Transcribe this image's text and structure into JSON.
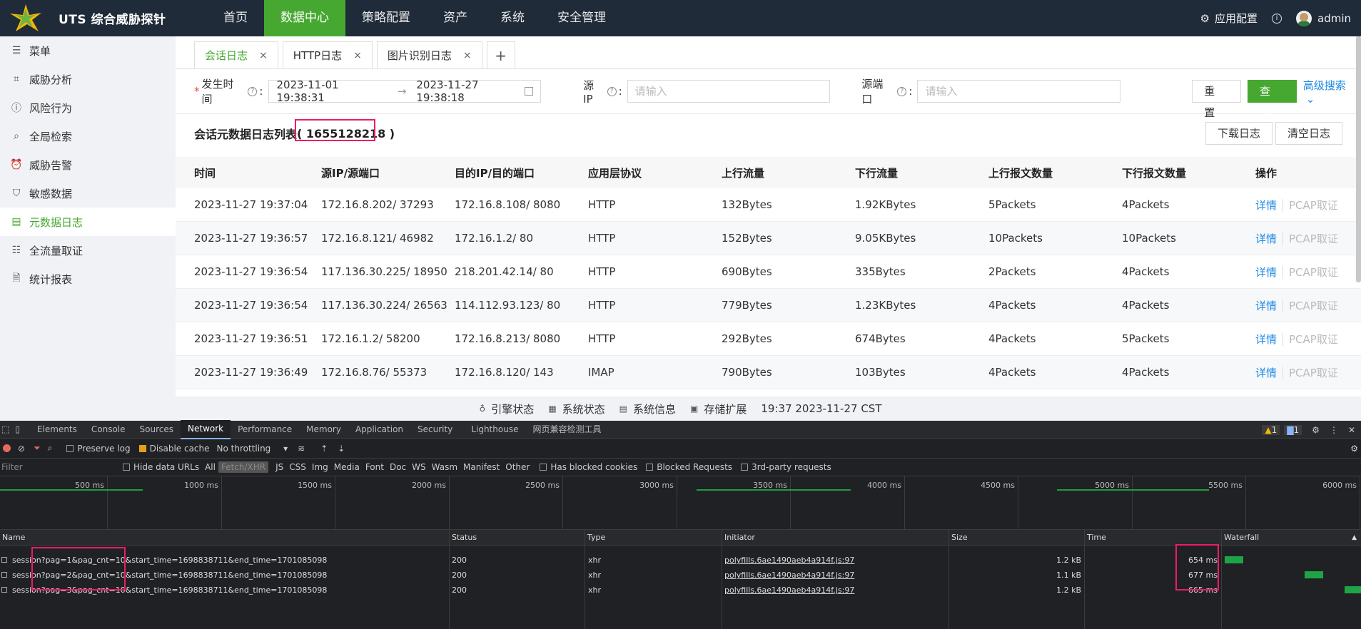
{
  "app": {
    "title": "UTS 综合威胁探针"
  },
  "nav": {
    "items": [
      {
        "label": "首页"
      },
      {
        "label": "数据中心"
      },
      {
        "label": "策略配置"
      },
      {
        "label": "资产"
      },
      {
        "label": "系统"
      },
      {
        "label": "安全管理"
      }
    ],
    "active": "数据中心"
  },
  "top_right": {
    "app_config": "应用配置",
    "user": "admin"
  },
  "sidebar": {
    "items": [
      {
        "label": "菜单",
        "icon": "menu-icon"
      },
      {
        "label": "威胁分析",
        "icon": "chart-icon"
      },
      {
        "label": "风险行为",
        "icon": "alert-circle-icon"
      },
      {
        "label": "全局检索",
        "icon": "search-icon"
      },
      {
        "label": "威胁告警",
        "icon": "alarm-icon"
      },
      {
        "label": "敏感数据",
        "icon": "shield-icon"
      },
      {
        "label": "元数据日志",
        "icon": "log-icon"
      },
      {
        "label": "全流量取证",
        "icon": "database-icon"
      },
      {
        "label": "统计报表",
        "icon": "report-icon"
      }
    ],
    "active": "元数据日志"
  },
  "tabs": [
    {
      "label": "会话日志",
      "close": "×"
    },
    {
      "label": "HTTP日志",
      "close": "×"
    },
    {
      "label": "图片识别日志",
      "close": "×"
    },
    {
      "label": "+"
    }
  ],
  "filters": {
    "time_label": "发生时间",
    "required_mark": "*",
    "colon": ":",
    "start": "2023-11-01 19:38:31",
    "arrow": "→",
    "end": "2023-11-27 19:38:18",
    "src_ip_label": "源IP",
    "src_ip_placeholder": "请输入",
    "src_port_label": "源端口",
    "src_port_placeholder": "请输入",
    "reset": "重 置",
    "query": "查 询",
    "advanced": "高级搜索"
  },
  "list": {
    "title": "会话元数据日志列表",
    "count": "( 1655128218 )",
    "download": "下载日志",
    "clear": "清空日志"
  },
  "table": {
    "columns": [
      "时间",
      "源IP/源端口",
      "目的IP/目的端口",
      "应用层协议",
      "上行流量",
      "下行流量",
      "上行报文数量",
      "下行报文数量",
      "操作"
    ],
    "rows": [
      {
        "time": "2023-11-27 19:37:04",
        "src": "172.16.8.202/ 37293",
        "dst": "172.16.8.108/ 8080",
        "proto": "HTTP",
        "up": "132Bytes",
        "down": "1.92KBytes",
        "up_pkts": "5Packets",
        "down_pkts": "4Packets"
      },
      {
        "time": "2023-11-27 19:36:57",
        "src": "172.16.8.121/ 46982",
        "dst": "172.16.1.2/ 80",
        "proto": "HTTP",
        "up": "152Bytes",
        "down": "9.05KBytes",
        "up_pkts": "10Packets",
        "down_pkts": "10Packets"
      },
      {
        "time": "2023-11-27 19:36:54",
        "src": "117.136.30.225/ 18950",
        "dst": "218.201.42.14/ 80",
        "proto": "HTTP",
        "up": "690Bytes",
        "down": "335Bytes",
        "up_pkts": "2Packets",
        "down_pkts": "4Packets"
      },
      {
        "time": "2023-11-27 19:36:54",
        "src": "117.136.30.224/ 26563",
        "dst": "114.112.93.123/ 80",
        "proto": "HTTP",
        "up": "779Bytes",
        "down": "1.23KBytes",
        "up_pkts": "4Packets",
        "down_pkts": "4Packets"
      },
      {
        "time": "2023-11-27 19:36:51",
        "src": "172.16.1.2/ 58200",
        "dst": "172.16.8.213/ 8080",
        "proto": "HTTP",
        "up": "292Bytes",
        "down": "674Bytes",
        "up_pkts": "4Packets",
        "down_pkts": "5Packets"
      },
      {
        "time": "2023-11-27 19:36:49",
        "src": "172.16.8.76/ 55373",
        "dst": "172.16.8.120/ 143",
        "proto": "IMAP",
        "up": "790Bytes",
        "down": "103Bytes",
        "up_pkts": "4Packets",
        "down_pkts": "4Packets"
      }
    ],
    "action_detail": "详情",
    "action_pcap": "PCAP取证"
  },
  "statusbar": {
    "engine": "引擎状态",
    "system": "系统状态",
    "sysinfo": "系统信息",
    "storage": "存储扩展",
    "clock": "19:37 2023-11-27 CST"
  },
  "devtools": {
    "tabs": [
      "Elements",
      "Console",
      "Sources",
      "Network",
      "Performance",
      "Memory",
      "Application",
      "Security",
      "Lighthouse",
      "网页兼容检测工具"
    ],
    "active_tab": "Network",
    "warnings": "1",
    "messages": "1",
    "toolbar": {
      "preserve_log": "Preserve log",
      "disable_cache": "Disable cache",
      "throttling": "No throttling"
    },
    "filter": {
      "placeholder": "Filter",
      "hide_data_urls": "Hide data URLs",
      "types": [
        "All",
        "Fetch/XHR",
        "JS",
        "CSS",
        "Img",
        "Media",
        "Font",
        "Doc",
        "WS",
        "Wasm",
        "Manifest",
        "Other"
      ],
      "active_type": "Fetch/XHR",
      "blocked_cookies": "Has blocked cookies",
      "blocked_requests": "Blocked Requests",
      "third_party": "3rd-party requests"
    },
    "timeline_ticks": [
      "500 ms",
      "1000 ms",
      "1500 ms",
      "2000 ms",
      "2500 ms",
      "3000 ms",
      "3500 ms",
      "4000 ms",
      "4500 ms",
      "5000 ms",
      "5500 ms",
      "6000 ms"
    ],
    "columns": [
      "Name",
      "Status",
      "Type",
      "Initiator",
      "Size",
      "Time",
      "Waterfall"
    ],
    "requests": [
      {
        "name": "session?pag=1&pag_cnt=10&start_time=1698838711&end_time=1701085098",
        "status": "200",
        "type": "xhr",
        "initiator": "polyfills.6ae1490aeb4a914f.js:97",
        "size": "1.2 kB",
        "time": "654 ms"
      },
      {
        "name": "session?pag=2&pag_cnt=10&start_time=1698838711&end_time=1701085098",
        "status": "200",
        "type": "xhr",
        "initiator": "polyfills.6ae1490aeb4a914f.js:97",
        "size": "1.1 kB",
        "time": "677 ms"
      },
      {
        "name": "session?pag=3&pag_cnt=10&start_time=1698838711&end_time=1701085098",
        "status": "200",
        "type": "xhr",
        "initiator": "polyfills.6ae1490aeb4a914f.js:97",
        "size": "1.2 kB",
        "time": "665 ms"
      }
    ]
  },
  "colors": {
    "brand_green": "#47a831",
    "header_bg": "#1f2b39",
    "link_blue": "#1e88e5",
    "highlight_red": "#e91e63"
  }
}
